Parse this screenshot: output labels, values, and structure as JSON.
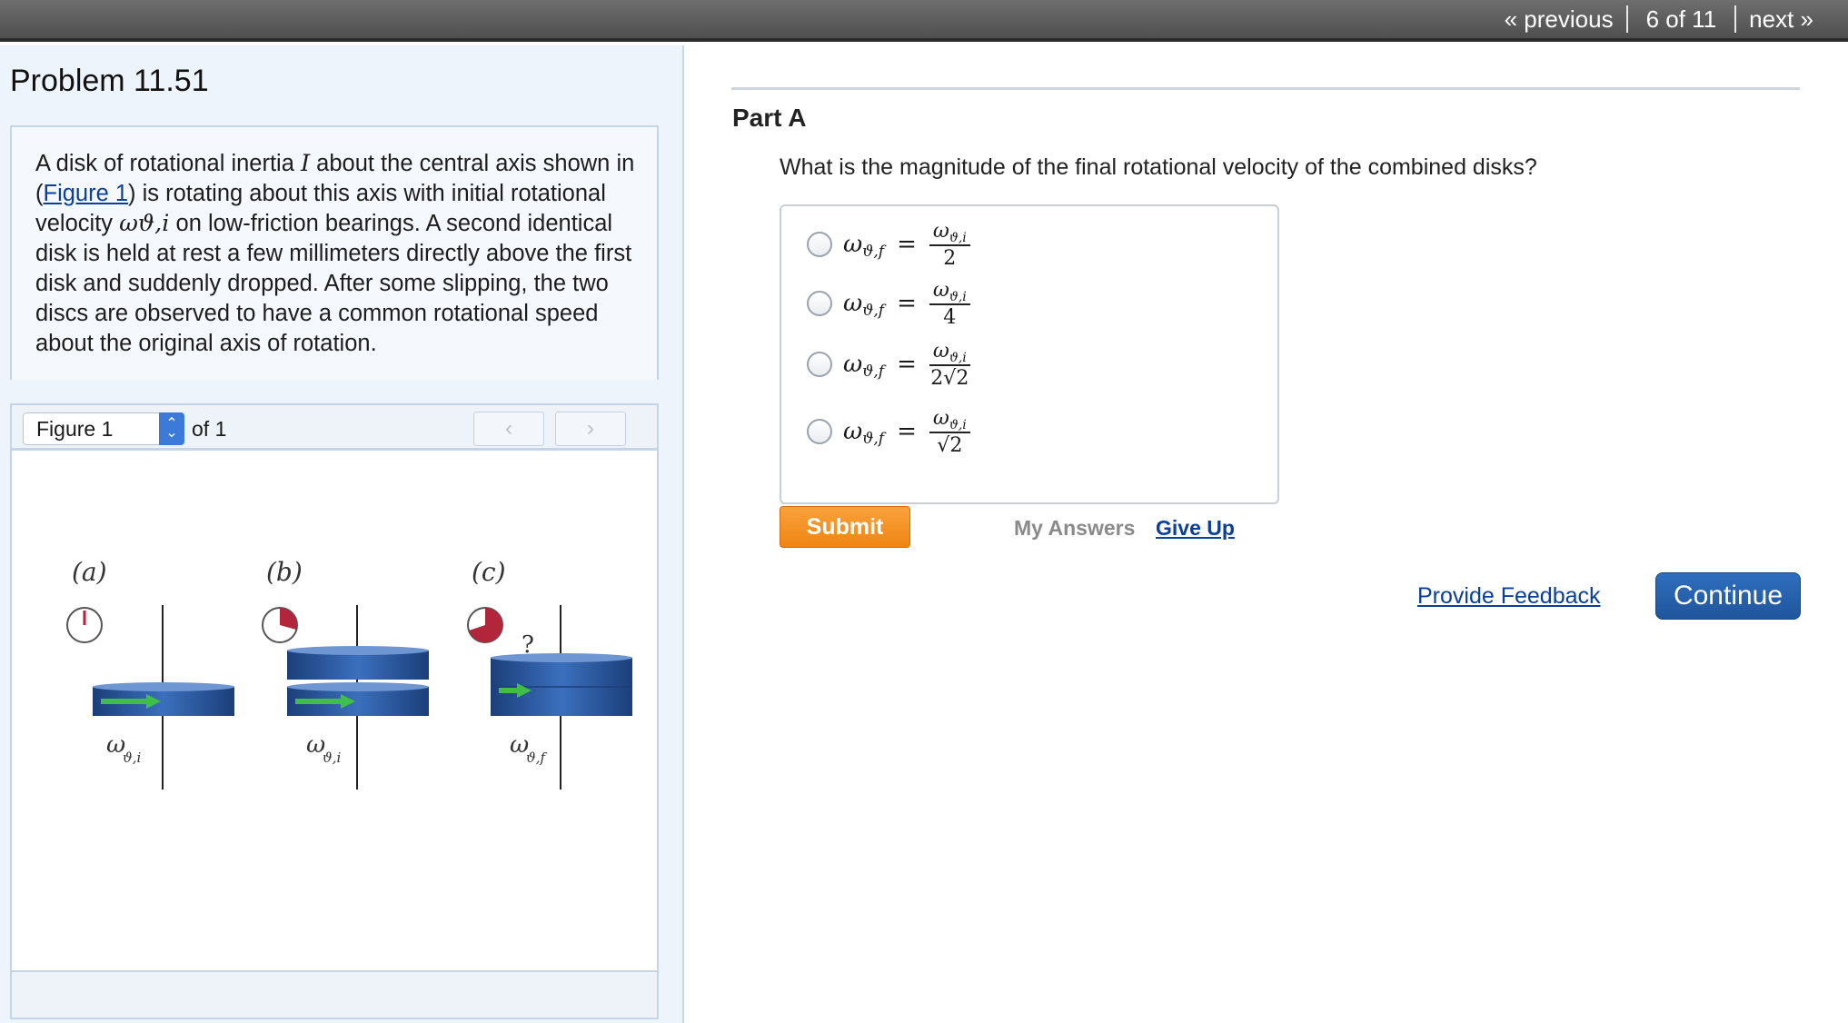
{
  "topnav": {
    "previous": "« previous",
    "position": "6 of 11",
    "next": "next »"
  },
  "problem": {
    "title": "Problem 11.51",
    "text_1": "A disk of rotational inertia ",
    "inertia_symbol": "I",
    "text_2": " about the central axis shown in (",
    "figure_link": "Figure 1",
    "text_3": ") is rotating about this axis with initial rotational velocity ",
    "omega_initial": "ωϑ,i",
    "text_4": " on low-friction bearings. A second identical disk is held at rest a few millimeters directly above the first disk and suddenly dropped. After some slipping, the two discs are observed to have a common rotational speed about the original axis of rotation."
  },
  "figure": {
    "selected": "Figure 1",
    "of_label": "of 1",
    "prev_icon": "chevron-left-icon",
    "next_icon": "chevron-right-icon",
    "panel_labels": [
      "(a)",
      "(b)",
      "(c)"
    ],
    "omega_labels": [
      {
        "symbol": "ω",
        "sub": "ϑ,i"
      },
      {
        "symbol": "ω",
        "sub": "ϑ,i"
      },
      {
        "symbol": "ω",
        "sub": "ϑ,f"
      }
    ],
    "question_mark": "?",
    "timer_fill_fractions": [
      0,
      0.3,
      0.6
    ],
    "colors": {
      "disk": "#2f5fa8",
      "disk_dark": "#1b3f7a",
      "arrow": "#3fbf4a",
      "timer": "#b3253a"
    }
  },
  "part": {
    "title": "Part A",
    "question": "What is the magnitude of the final rotational velocity of the combined disks?",
    "choices": [
      {
        "lhs": "ω",
        "lhs_sub": "ϑ,f",
        "num": "ω",
        "num_sub": "ϑ,i",
        "den": "2"
      },
      {
        "lhs": "ω",
        "lhs_sub": "ϑ,f",
        "num": "ω",
        "num_sub": "ϑ,i",
        "den": "4"
      },
      {
        "lhs": "ω",
        "lhs_sub": "ϑ,f",
        "num": "ω",
        "num_sub": "ϑ,i",
        "den": "2√2"
      },
      {
        "lhs": "ω",
        "lhs_sub": "ϑ,f",
        "num": "ω",
        "num_sub": "ϑ,i",
        "den": "√2"
      }
    ],
    "submit": "Submit",
    "my_answers": "My Answers",
    "give_up": "Give Up"
  },
  "footer": {
    "feedback": "Provide Feedback",
    "continue": "Continue"
  }
}
